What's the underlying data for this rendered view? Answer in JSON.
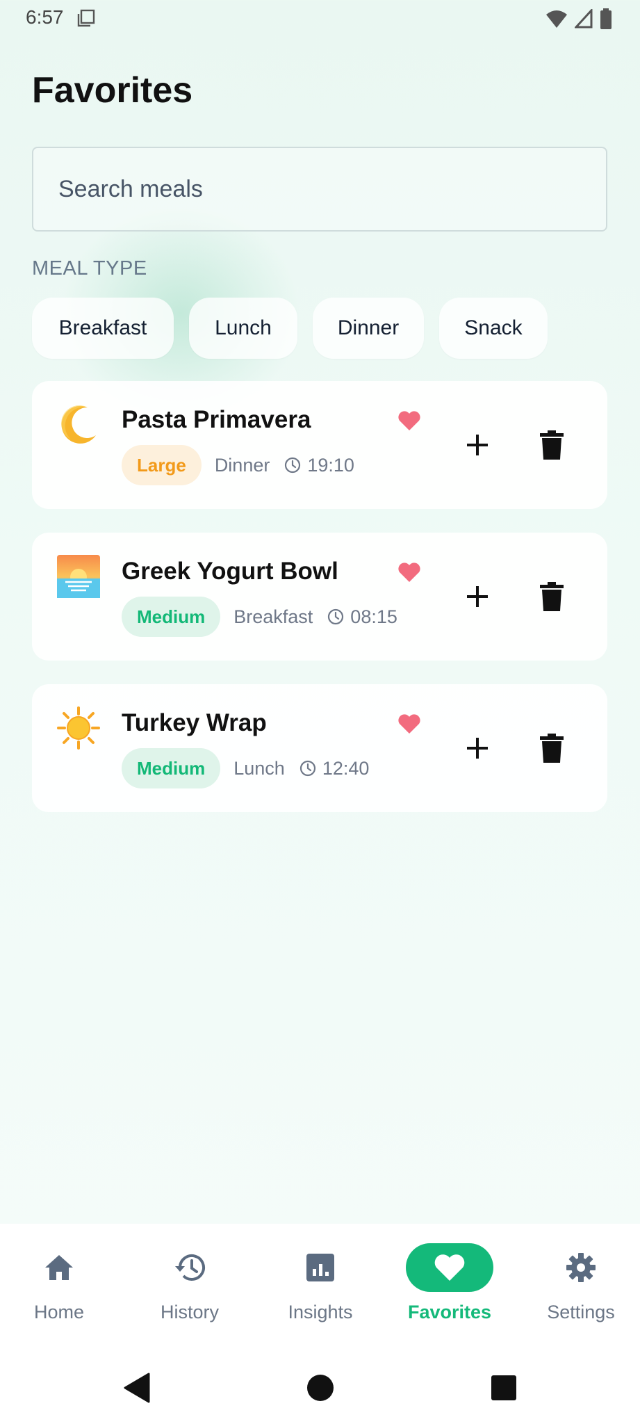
{
  "status_bar": {
    "time": "6:57"
  },
  "title": "Favorites",
  "search": {
    "placeholder": "Search meals",
    "value": ""
  },
  "filter_section": {
    "label": "MEAL TYPE",
    "chips": [
      "Breakfast",
      "Lunch",
      "Dinner",
      "Snack"
    ]
  },
  "meals": [
    {
      "name": "Pasta Primavera",
      "icon": "crescent-moon-emoji",
      "size": "Large",
      "size_color": "#f29a1a",
      "type": "Dinner",
      "time": "19:10",
      "favorite": true
    },
    {
      "name": "Greek Yogurt Bowl",
      "icon": "sunrise-emoji",
      "size": "Medium",
      "size_color": "#13b877",
      "type": "Breakfast",
      "time": "08:15",
      "favorite": true
    },
    {
      "name": "Turkey Wrap",
      "icon": "sun-emoji",
      "size": "Medium",
      "size_color": "#13b877",
      "type": "Lunch",
      "time": "12:40",
      "favorite": true
    }
  ],
  "bottom_nav": {
    "items": [
      {
        "label": "Home",
        "icon": "home-icon",
        "active": false
      },
      {
        "label": "History",
        "icon": "history-icon",
        "active": false
      },
      {
        "label": "Insights",
        "icon": "insights-icon",
        "active": false
      },
      {
        "label": "Favorites",
        "icon": "heart-icon",
        "active": true
      },
      {
        "label": "Settings",
        "icon": "gear-icon",
        "active": false
      }
    ]
  },
  "colors": {
    "accent": "#14b97a",
    "heart": "#f26b7e",
    "muted_text": "#6f7888"
  }
}
